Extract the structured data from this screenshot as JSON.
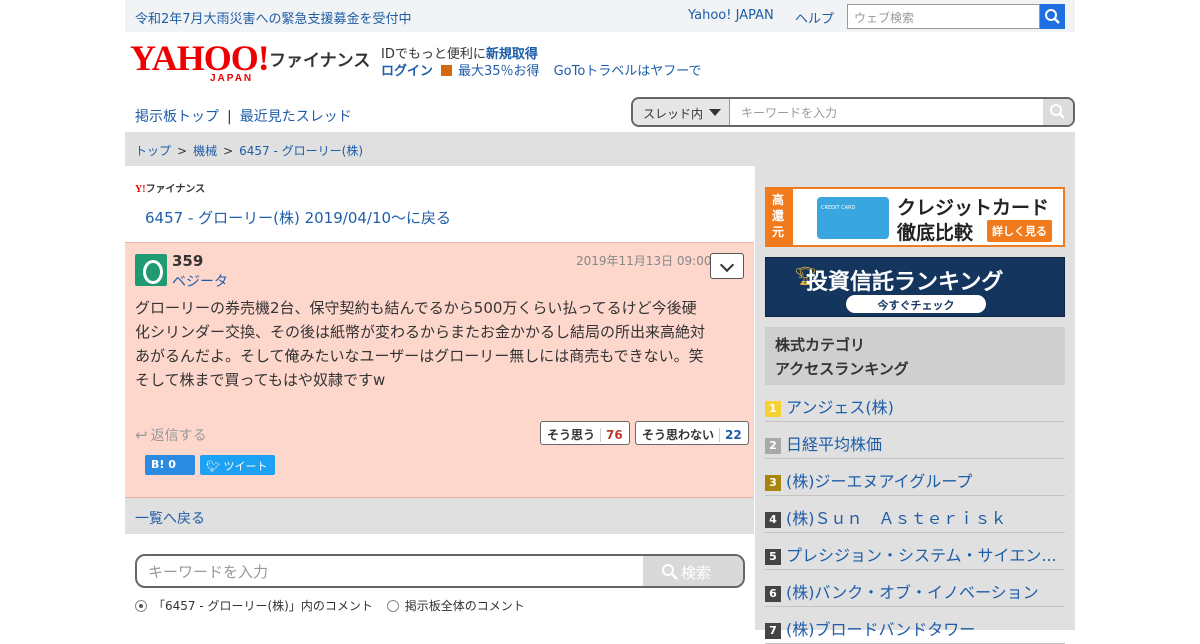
{
  "topbar": {
    "notice": "令和2年7月大雨災害への緊急支援募金を受付中",
    "yahoo_japan": "Yahoo! JAPAN",
    "help": "ヘルプ",
    "web_search_placeholder": "ウェブ検索"
  },
  "header": {
    "logo_main": "YAHOO!",
    "logo_sub": "JAPAN",
    "finance_label": "ファイナンス",
    "id_text": "IDでもっと便利に",
    "register": "新規取得",
    "login": "ログイン",
    "promo": "最大35％お得",
    "goto": "GoToトラベルはヤフーで"
  },
  "boardnav": {
    "board_top": "掲示板トップ",
    "separator": "|",
    "recent_threads": "最近見たスレッド",
    "scope_select": "スレッド内",
    "keyword_placeholder": "キーワードを入力"
  },
  "breadcrumb": {
    "items": [
      "トップ",
      "機械",
      "6457 - グローリー(株)"
    ],
    "sep": ">"
  },
  "main": {
    "mini_logo_y": "Y!",
    "mini_logo_text": "ファイナンス",
    "back_link": "6457 - グローリー(株) 2019/04/10〜に戻る",
    "comment": {
      "number": "359",
      "user": "ベジータ",
      "date": "2019年11月13日 09:00",
      "lines": [
        "グローリーの券売機2台、保守契約も結んでるから500万くらい払ってるけど今後硬",
        "化シリンダー交換、その後は紙幣が変わるからまたお金かかるし結局の所出来高絶対",
        "あがるんだよ。そして俺みたいなユーザーはグローリー無しには商売もできない。笑",
        "そして株まで買ってもはや奴隷ですw"
      ],
      "reply_label": "返信する",
      "agree_label": "そう思う",
      "agree_count": "76",
      "disagree_label": "そう思わない",
      "disagree_count": "22",
      "hatena_label": "B!",
      "hatena_count": "0",
      "tweet_label": "ツイート"
    },
    "back_to_list": "一覧へ戻る",
    "keyword_placeholder": "キーワードを入力",
    "search_button": "検索",
    "radio_thread": "「6457 - グローリー(株)」内のコメント",
    "radio_all": "掲示板全体のコメント"
  },
  "side": {
    "banner_credit": {
      "tag": "高還元",
      "card_text": "CREDIT CARD",
      "title1": "クレジットカード",
      "title2": "徹底比較",
      "more": "詳しく見る"
    },
    "banner_fund": {
      "title": "投資信託ランキング",
      "check": "今すぐチェック"
    },
    "ranking_head_1": "株式カテゴリ",
    "ranking_head_2": "アクセスランキング",
    "ranking": [
      {
        "rank": "1",
        "name": "アンジェス(株)"
      },
      {
        "rank": "2",
        "name": "日経平均株価"
      },
      {
        "rank": "3",
        "name": "(株)ジーエヌアイグループ"
      },
      {
        "rank": "4",
        "name": "(株)Ｓｕｎ　Ａｓｔｅｒｉｓｋ"
      },
      {
        "rank": "5",
        "name": "プレシジョン・システム・サイエン..."
      },
      {
        "rank": "6",
        "name": "(株)バンク・オブ・イノベーション"
      },
      {
        "rank": "7",
        "name": "(株)ブロードバンドタワー"
      }
    ]
  },
  "colors": {
    "link": "#1e5da8",
    "comment_bg": "#fdd7cc",
    "brand_red": "#e00000",
    "search_blue": "#1f6fe0"
  }
}
